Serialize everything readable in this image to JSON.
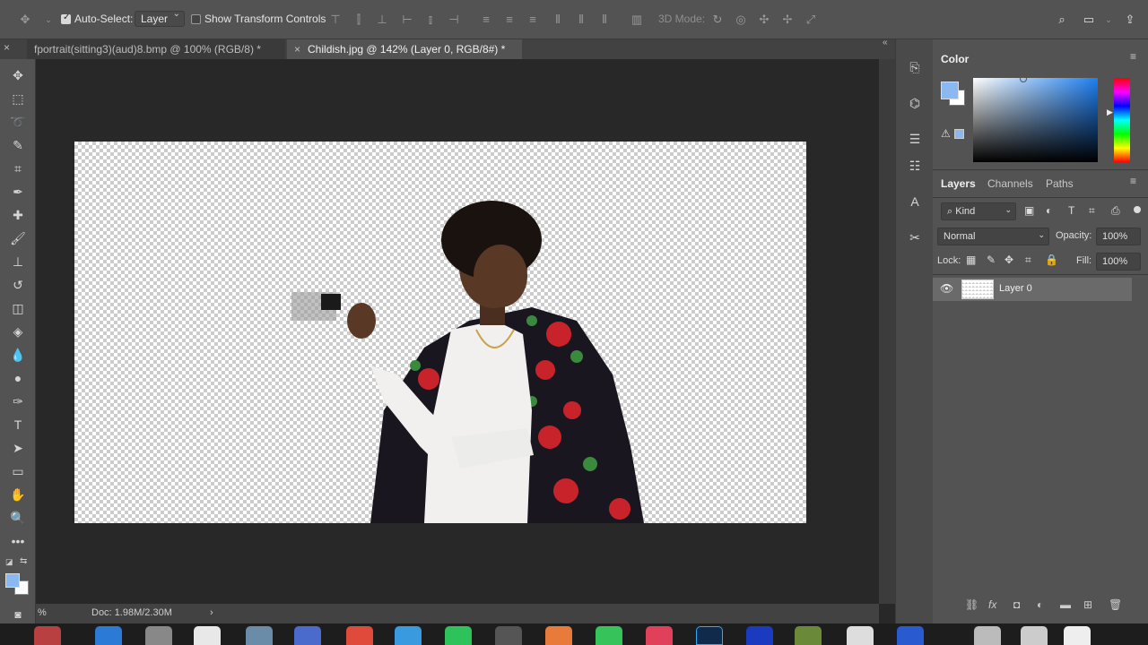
{
  "options_bar": {
    "auto_select_label": "Auto-Select:",
    "auto_select_checked": true,
    "auto_select_mode": "Layer",
    "show_transform_label": "Show Transform Controls",
    "show_transform_checked": false,
    "mode_3d_label": "3D Mode:"
  },
  "tabs": [
    {
      "label": "fportrait(sitting3)(aud)8.bmp @ 100% (RGB/8) *",
      "active": false
    },
    {
      "label": "Childish.jpg @ 142% (Layer 0, RGB/8#) *",
      "active": true
    }
  ],
  "status": {
    "zoom": "%",
    "doc_size": "Doc: 1.98M/2.30M"
  },
  "color_panel": {
    "title": "Color",
    "foreground": "#8ab8f0",
    "background": "#ffffff"
  },
  "layers_panel": {
    "tabs": [
      "Layers",
      "Channels",
      "Paths"
    ],
    "filter_kind": "Kind",
    "blend_mode": "Normal",
    "opacity_label": "Opacity:",
    "opacity_value": "100%",
    "lock_label": "Lock:",
    "fill_label": "Fill:",
    "fill_value": "100%",
    "layers": [
      {
        "name": "Layer 0",
        "visible": true
      }
    ]
  },
  "colors": {
    "ui_bg": "#535353",
    "workspace": "#282828",
    "accent_blue": "#8ab8f0"
  }
}
